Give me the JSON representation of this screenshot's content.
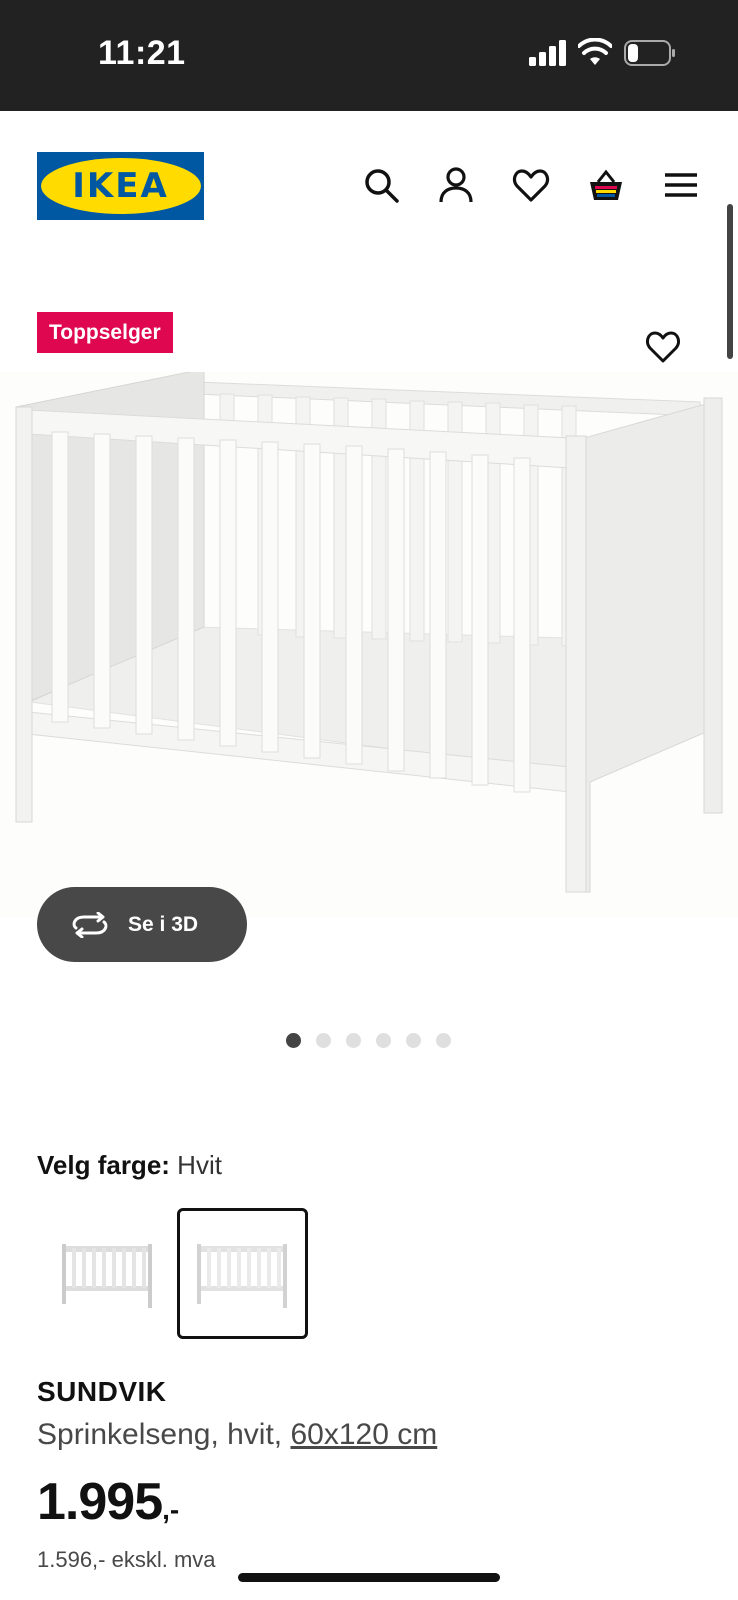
{
  "status_bar": {
    "time": "11:21"
  },
  "header": {
    "logo_text": "IKEA",
    "icons": [
      "search-icon",
      "user-icon",
      "heart-icon",
      "basket-icon",
      "menu-icon"
    ]
  },
  "badge": {
    "label": "Toppselger"
  },
  "gallery": {
    "button_3d_label": "Se i 3D",
    "dots_count": 6,
    "active_dot": 1
  },
  "color": {
    "label": "Velg farge:",
    "value": "Hvit"
  },
  "product": {
    "name": "SUNDVIK",
    "description": "Sprinkelseng, hvit, ",
    "size": "60x120 cm",
    "price": "1.995",
    "price_suffix": ",-",
    "price_ex_vat": "1.596,- ekskl. mva"
  },
  "colors": {
    "accent_badge": "#e00751",
    "ikea_blue": "#0058a3",
    "ikea_yellow": "#ffdb00"
  }
}
